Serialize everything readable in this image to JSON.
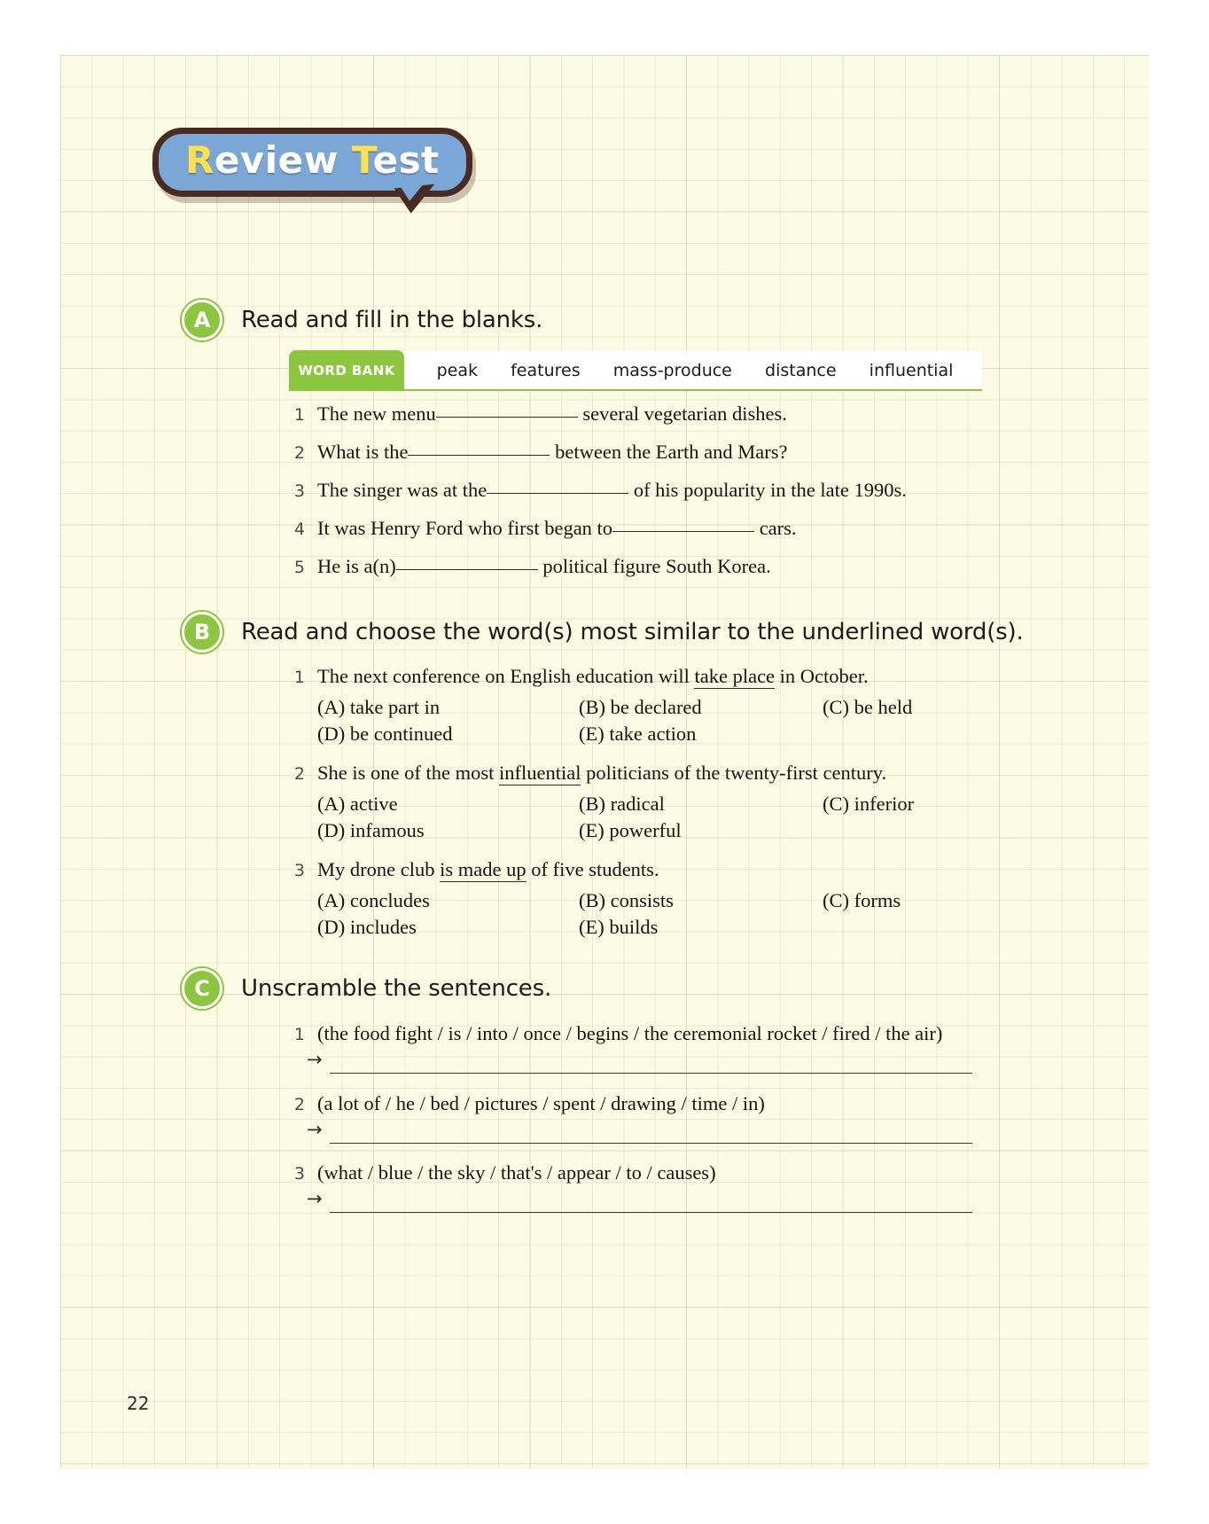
{
  "title": {
    "line_full": "Review Test",
    "part1_highlight": "R",
    "part1_rest": "eview ",
    "part2_highlight": "T",
    "part2_rest": "est"
  },
  "colors": {
    "page_background": "#fbfbe4",
    "title_bubble_fill": "#7ba7d7",
    "title_bubble_border": "#4a2b21",
    "title_highlight": "#ffe14d",
    "accent_green": "#8cc63e",
    "text": "#17140f"
  },
  "sections": [
    {
      "letter": "A",
      "instruction": "Read and fill in the blanks.",
      "word_bank": {
        "label": "WORD BANK",
        "words": [
          "peak",
          "features",
          "mass-produce",
          "distance",
          "influential"
        ]
      },
      "questions": [
        {
          "num": "1",
          "before": "The new menu",
          "blank_width": 160,
          "after": "several vegetarian dishes."
        },
        {
          "num": "2",
          "before": "What is the",
          "blank_width": 160,
          "after": "between the Earth and Mars?"
        },
        {
          "num": "3",
          "before": "The singer was at the",
          "blank_width": 160,
          "after": "of his popularity in the late 1990s."
        },
        {
          "num": "4",
          "before": "It was Henry Ford who first began to",
          "blank_width": 160,
          "after": "cars."
        },
        {
          "num": "5",
          "before": "He is a(n)",
          "blank_width": 160,
          "after": "political figure South Korea."
        }
      ]
    },
    {
      "letter": "B",
      "instruction": "Read and choose the word(s) most similar to the underlined word(s).",
      "questions": [
        {
          "num": "1",
          "pre": "The next conference on English education will ",
          "underlined": "take place",
          "post": " in October.",
          "choices": [
            "(A) take part in",
            "(B) be declared",
            "(C) be held",
            "(D) be continued",
            "(E) take action"
          ]
        },
        {
          "num": "2",
          "pre": "She is one of the most ",
          "underlined": "influential",
          "post": " politicians of the twenty-first century.",
          "choices": [
            "(A) active",
            "(B) radical",
            "(C) inferior",
            "(D) infamous",
            "(E) powerful"
          ]
        },
        {
          "num": "3",
          "pre": "My drone club ",
          "underlined": "is made up",
          "post": " of five students.",
          "choices": [
            "(A) concludes",
            "(B) consists",
            "(C) forms",
            "(D) includes",
            "(E) builds"
          ]
        }
      ]
    },
    {
      "letter": "C",
      "instruction": "Unscramble the sentences.",
      "arrow_glyph": "→",
      "questions": [
        {
          "num": "1",
          "scrambled": "(the food fight / is / into / once / begins / the ceremonial rocket / fired / the air)",
          "answer": ""
        },
        {
          "num": "2",
          "scrambled": "(a lot of / he / bed / pictures / spent / drawing / time / in)",
          "answer": ""
        },
        {
          "num": "3",
          "scrambled": "(what / blue / the sky / that's / appear / to / causes)",
          "answer": ""
        }
      ]
    }
  ],
  "footer": {
    "page_number": "22"
  }
}
